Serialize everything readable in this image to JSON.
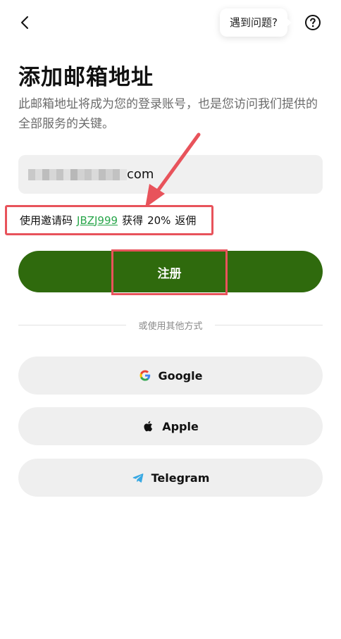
{
  "header": {
    "help_tooltip": "遇到问题?"
  },
  "title": "添加邮箱地址",
  "description": "此邮箱地址将成为您的登录账号，也是您访问我们提供的全部服务的关键。",
  "email": {
    "visible_suffix": "com"
  },
  "invite": {
    "prefix": "使用邀请码",
    "code": "JBZJ999",
    "middle": "获得",
    "percent": "20%",
    "suffix": "返佣"
  },
  "register_button": "注册",
  "divider_text": "或使用其他方式",
  "social": [
    {
      "label": "Google",
      "icon": "google-icon"
    },
    {
      "label": "Apple",
      "icon": "apple-icon"
    },
    {
      "label": "Telegram",
      "icon": "telegram-icon"
    }
  ],
  "colors": {
    "primary": "#2f6a0d",
    "invite_code": "#29a64b",
    "annotation_red": "#e8535b",
    "field_bg": "#f0f0f0"
  }
}
